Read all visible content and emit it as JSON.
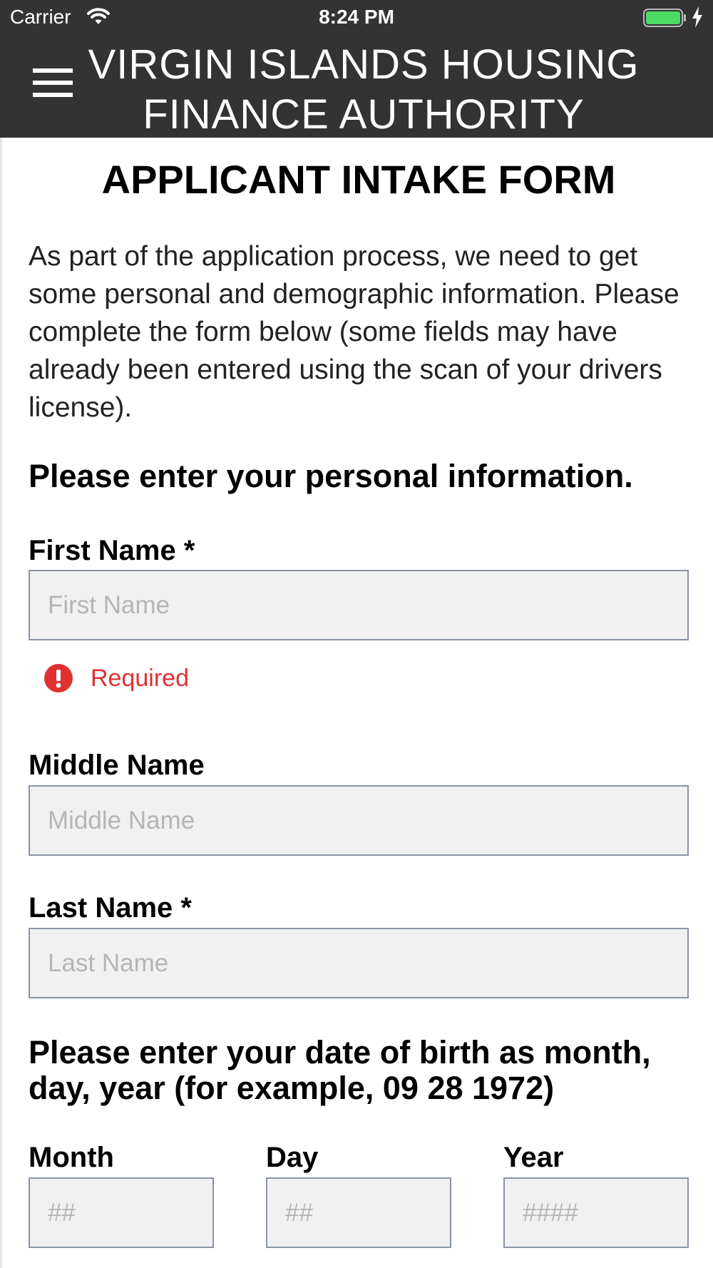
{
  "status_bar": {
    "carrier": "Carrier",
    "time": "8:24 PM",
    "icons": [
      "wifi-icon",
      "battery-icon",
      "charging-bolt-icon"
    ],
    "battery_color": "#4cd964"
  },
  "app_bar": {
    "title": "VIRGIN ISLANDS HOUSING FINANCE AUTHORITY",
    "menu_icon": "hamburger-menu-icon",
    "background": "#333333"
  },
  "form": {
    "title": "APPLICANT INTAKE FORM",
    "intro": "As part of the application process, we need to get some personal and demographic information. Please complete the form below (some fields may have already been entered using the scan of your drivers license).",
    "personal_heading": "Please enter your personal information.",
    "first_name": {
      "label": "First Name *",
      "placeholder": "First Name",
      "value": "",
      "error": "Required",
      "error_icon": "exclamation-circle-icon",
      "error_color": "#e03131"
    },
    "middle_name": {
      "label": "Middle Name",
      "placeholder": "Middle Name",
      "value": ""
    },
    "last_name": {
      "label": "Last Name *",
      "placeholder": "Last Name",
      "value": ""
    },
    "dob_heading": "Please enter your date of birth as month, day, year (for example, 09 28 1972)",
    "month": {
      "label": "Month",
      "placeholder": "##",
      "value": ""
    },
    "day": {
      "label": "Day",
      "placeholder": "##",
      "value": ""
    },
    "year": {
      "label": "Year",
      "placeholder": "####",
      "value": ""
    }
  }
}
